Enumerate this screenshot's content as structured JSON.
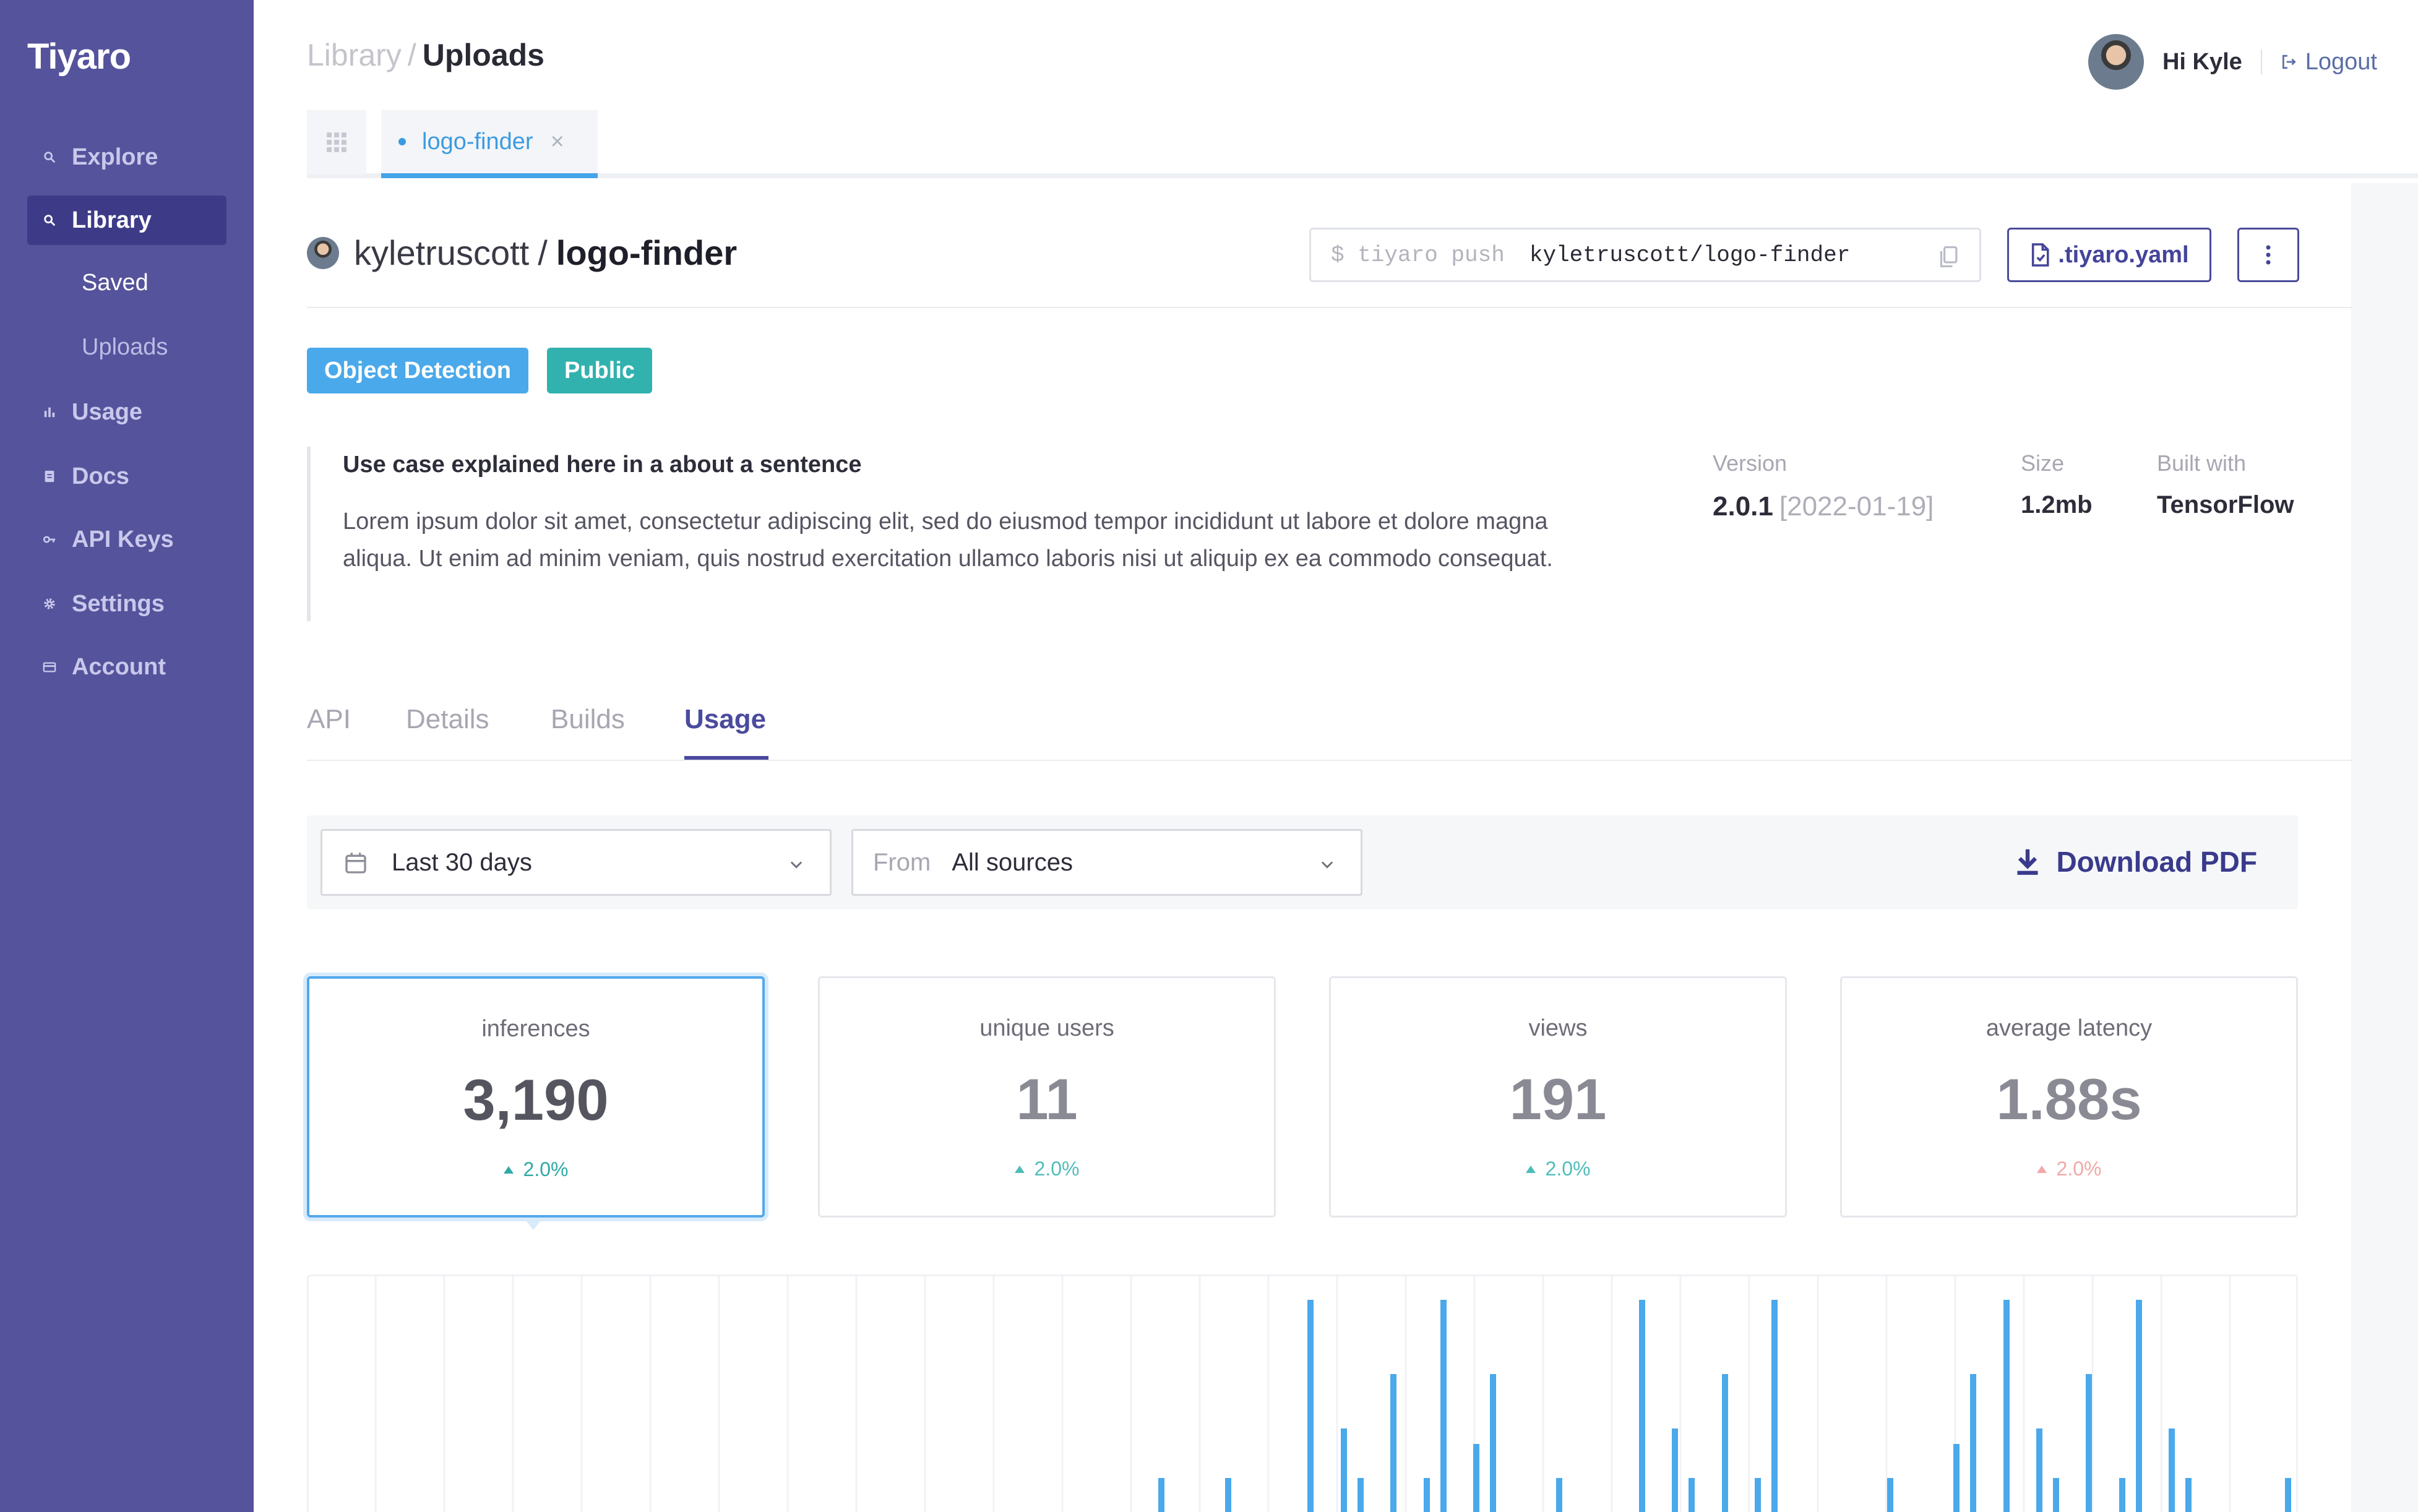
{
  "app": {
    "brand": "Tiyaro"
  },
  "sidebar": {
    "items": [
      {
        "label": "Explore",
        "icon": "search-icon"
      },
      {
        "label": "Library",
        "icon": "search-icon",
        "active": true
      },
      {
        "label": "Usage",
        "icon": "bar-chart-icon"
      },
      {
        "label": "Docs",
        "icon": "document-icon"
      },
      {
        "label": "API Keys",
        "icon": "key-icon"
      },
      {
        "label": "Settings",
        "icon": "gear-icon"
      },
      {
        "label": "Account",
        "icon": "card-icon"
      }
    ],
    "library_sub": [
      {
        "label": "Saved"
      },
      {
        "label": "Uploads"
      }
    ]
  },
  "header": {
    "breadcrumb_parent": "Library",
    "breadcrumb_sep": "/",
    "breadcrumb_current": "Uploads",
    "greeting": "Hi Kyle",
    "logout": "Logout"
  },
  "tabs": {
    "open_file": "logo-finder",
    "close_glyph": "×"
  },
  "model": {
    "owner": "kyletruscott",
    "sep": "/",
    "name": "logo-finder",
    "cmd_prompt": "$ tiyaro push",
    "cmd_value": "kyletruscott/logo-finder",
    "yaml_button": ".tiyaro.yaml",
    "badges": [
      {
        "label": "Object Detection",
        "color": "#4aa9ea"
      },
      {
        "label": "Public",
        "color": "#31b2ae"
      }
    ],
    "use_case": "Use case explained here in a about a sentence",
    "description": "Lorem ipsum dolor sit amet, consectetur adipiscing elit, sed do eiusmod tempor incididunt ut labore et dolore magna aliqua. Ut enim ad minim veniam, quis nostrud exercitation ullamco laboris nisi ut aliquip ex ea commodo consequat.",
    "meta": {
      "version_label": "Version",
      "version": "2.0.1",
      "version_date": "[2022-01-19]",
      "size_label": "Size",
      "size": "1.2mb",
      "built_label": "Built with",
      "built": "TensorFlow"
    }
  },
  "section_tabs": [
    {
      "label": "API"
    },
    {
      "label": "Details"
    },
    {
      "label": "Builds"
    },
    {
      "label": "Usage",
      "active": true
    }
  ],
  "filters": {
    "range": "Last 30 days",
    "source_prefix": "From",
    "source": "All sources",
    "download": "Download PDF"
  },
  "stats": [
    {
      "label": "inferences",
      "value": "3,190",
      "delta": "2.0%",
      "delta_color": "#2fa9a4",
      "selected": true
    },
    {
      "label": "unique users",
      "value": "11",
      "delta": "2.0%",
      "delta_color": "#4fbdb9"
    },
    {
      "label": "views",
      "value": "191",
      "delta": "2.0%",
      "delta_color": "#4fbdb9"
    },
    {
      "label": "average latency",
      "value": "1.88s",
      "delta": "2.0%",
      "delta_color": "#f3a7a7"
    }
  ],
  "colors": {
    "sidebar": "#55539b",
    "sidebar_active": "#3d3b88",
    "accent": "#4a4a9e",
    "chart_bar": "#4aa9ea"
  },
  "chart_data": {
    "type": "bar",
    "bar_color": "#4aa9ea",
    "note_values": "relative bar heights (top of visible area = 1.0), 0 = no bar",
    "values": [
      0,
      0,
      0,
      0,
      0,
      0,
      0,
      0,
      0,
      0,
      0,
      0,
      0,
      0,
      0,
      0,
      0,
      0,
      0,
      0,
      0,
      0,
      0,
      0,
      0,
      0,
      0,
      0,
      0,
      0,
      0,
      0,
      0,
      0,
      0,
      0,
      0,
      0,
      0,
      0,
      0,
      0,
      0,
      0,
      0,
      0,
      0,
      0,
      0,
      0,
      0,
      0.16,
      0,
      0,
      0,
      0.16,
      0,
      0,
      0,
      0,
      0.95,
      0,
      0.38,
      0.16,
      0,
      0.62,
      0,
      0.16,
      0.95,
      0,
      0.31,
      0.62,
      0,
      0,
      0,
      0.16,
      0,
      0,
      0,
      0,
      0.95,
      0,
      0.38,
      0.16,
      0,
      0.62,
      0,
      0.16,
      0.95,
      0,
      0,
      0,
      0,
      0,
      0,
      0.16,
      0,
      0,
      0,
      0.31,
      0.62,
      0,
      0.95,
      0,
      0.38,
      0.16,
      0,
      0.62,
      0,
      0.16,
      0.95,
      0,
      0.38,
      0.16,
      0,
      0,
      0,
      0,
      0,
      0.16
    ]
  }
}
